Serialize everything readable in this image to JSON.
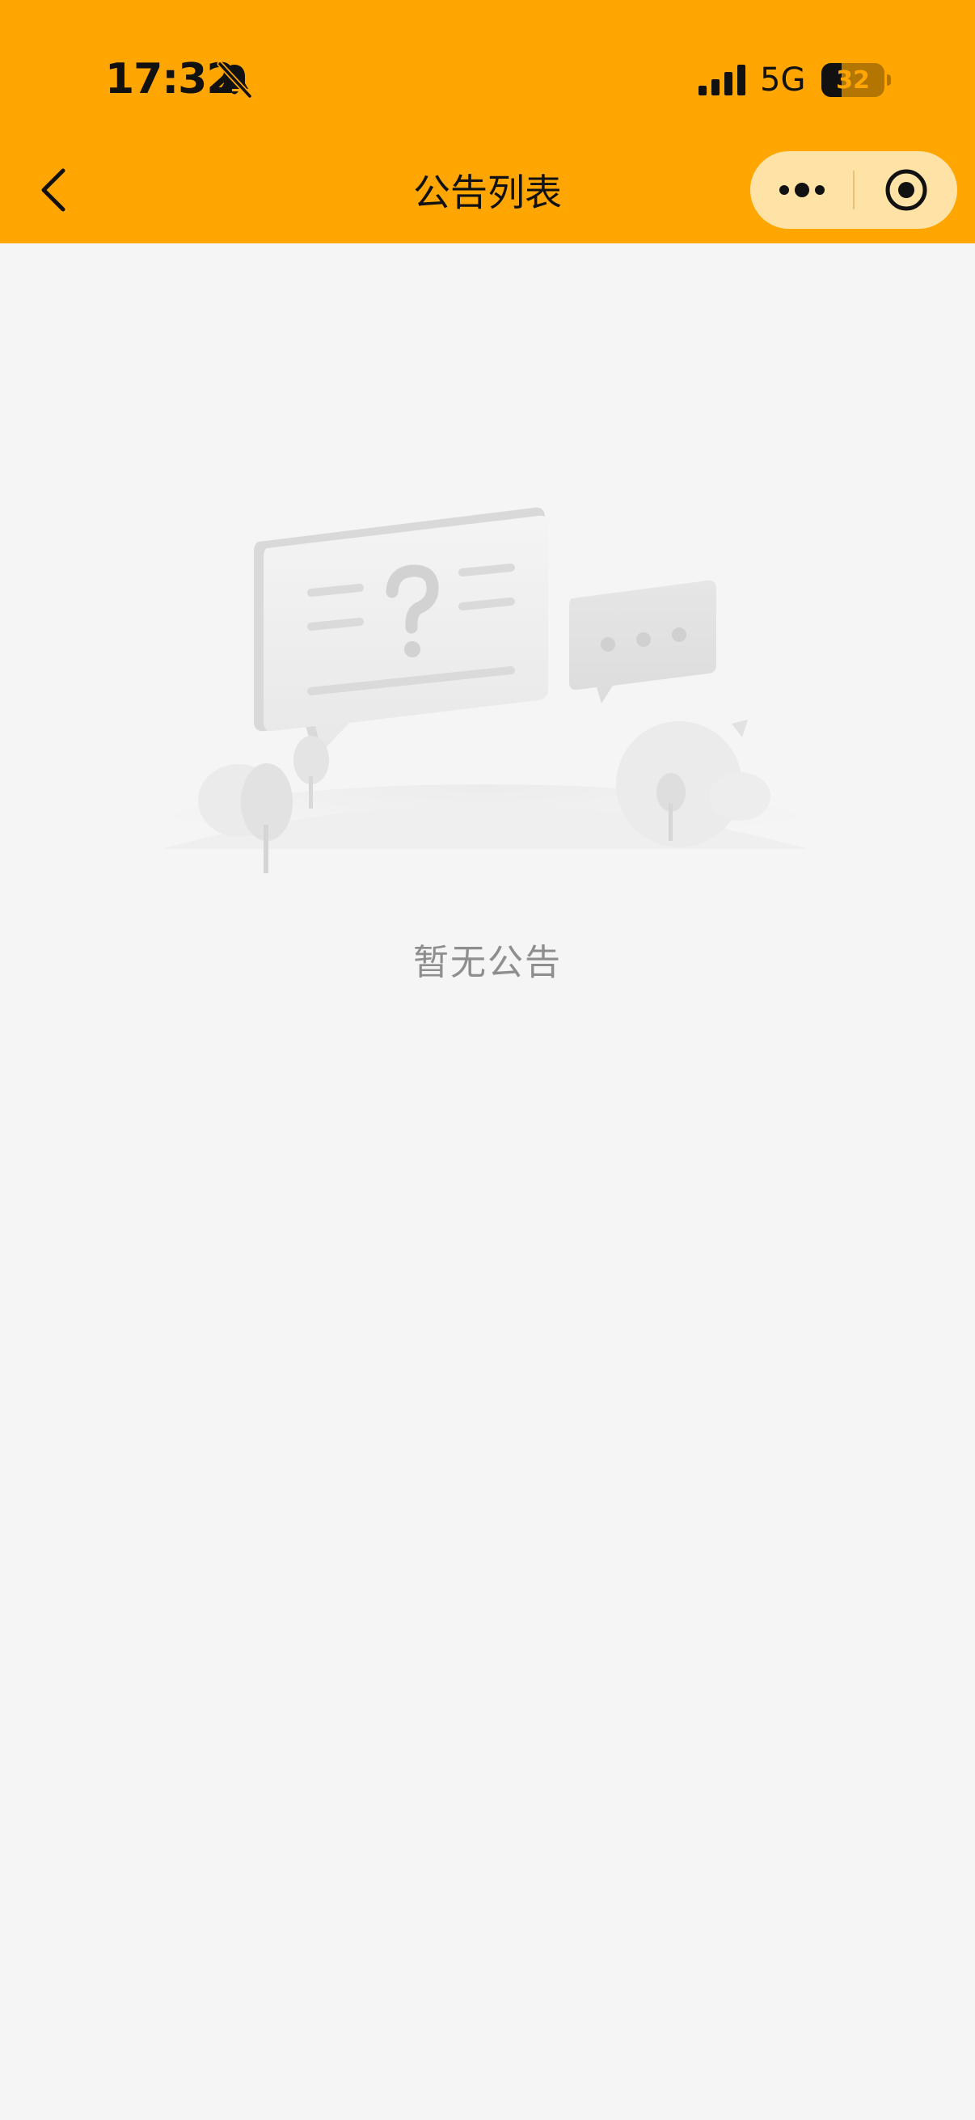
{
  "status_bar": {
    "time": "17:32",
    "network": "5G",
    "battery_level": "32",
    "battery_fraction": 0.32
  },
  "nav_bar": {
    "title": "公告列表"
  },
  "empty_state": {
    "text": "暂无公告"
  },
  "colors": {
    "header_bg": "#ffa602",
    "page_bg": "#f5f5f5",
    "capsule_bg": "#ffe3a6",
    "empty_text": "#8e8e8e"
  },
  "icons": {
    "back": "chevron-left-icon",
    "more": "more-dots-icon",
    "close": "target-circle-icon",
    "mute": "bell-off-icon",
    "signal": "signal-bars-icon"
  }
}
